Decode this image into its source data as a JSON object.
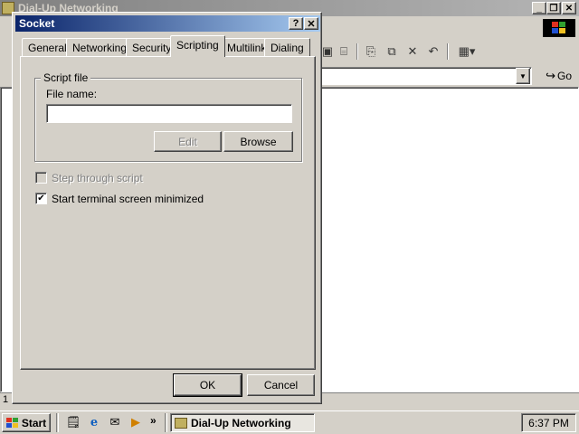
{
  "background_window": {
    "title": "Dial-Up Networking",
    "go_label": "Go",
    "status_text": "1"
  },
  "dialog": {
    "title": "Socket",
    "help_glyph": "?",
    "close_glyph": "✕",
    "tabs": [
      {
        "label": "General"
      },
      {
        "label": "Networking"
      },
      {
        "label": "Security"
      },
      {
        "label": "Scripting"
      },
      {
        "label": "Multilink"
      },
      {
        "label": "Dialing"
      }
    ],
    "active_tab": "Scripting",
    "script_file": {
      "group_label": "Script file",
      "file_name_label": "File name:",
      "file_name_value": "",
      "edit_label": "Edit",
      "browse_label": "Browse"
    },
    "step_through": {
      "label": "Step through script",
      "checked": false,
      "enabled": false
    },
    "start_minimized": {
      "label": "Start terminal screen minimized",
      "checked": true
    },
    "ok_label": "OK",
    "cancel_label": "Cancel"
  },
  "taskbar": {
    "start_label": "Start",
    "chevron": "»",
    "task_label": "Dial-Up Networking",
    "clock": "6:37 PM"
  },
  "colors": {
    "titlebar_active": "#0a246a",
    "titlebar_inactive": "#808080",
    "face": "#d4d0c8"
  }
}
